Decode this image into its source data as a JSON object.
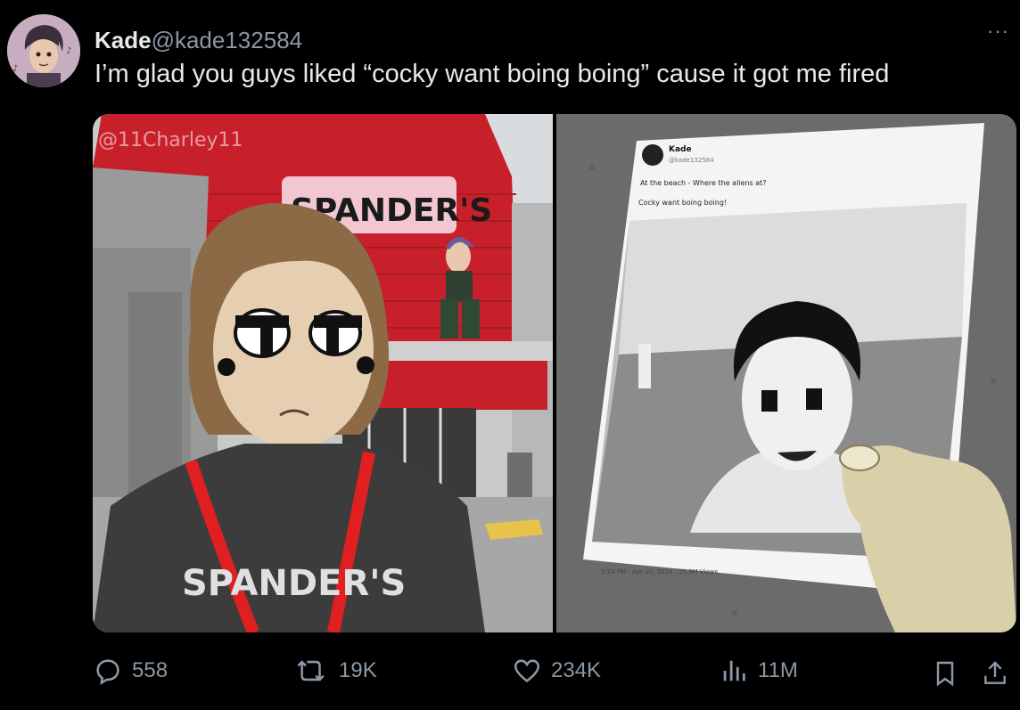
{
  "tweet": {
    "author_name": "Kade",
    "author_handle": "@kade132584",
    "text": "I’m glad you guys liked “cocky want boing boing” cause it got me fired",
    "more_label": "···"
  },
  "media": {
    "left_art": {
      "watermark": "@11Charley11",
      "store_sign": "SPANDER'S",
      "shirt_text": "SPANDER'S"
    },
    "right_art": {
      "paper_author": "Kade",
      "paper_handle": "@kade132584",
      "paper_line1": "At the beach - Where the aliens at?",
      "paper_line2": "Cocky want boing boing!",
      "paper_meta": "5:24 PM · Apr 10, 2024 · 25.9M Views"
    }
  },
  "actions": {
    "replies": "558",
    "reposts": "19K",
    "likes": "234K",
    "views": "11M"
  },
  "colors": {
    "background": "#000000",
    "text": "#e7e9ea",
    "muted": "#8b98a5",
    "store_red": "#c8202b"
  }
}
